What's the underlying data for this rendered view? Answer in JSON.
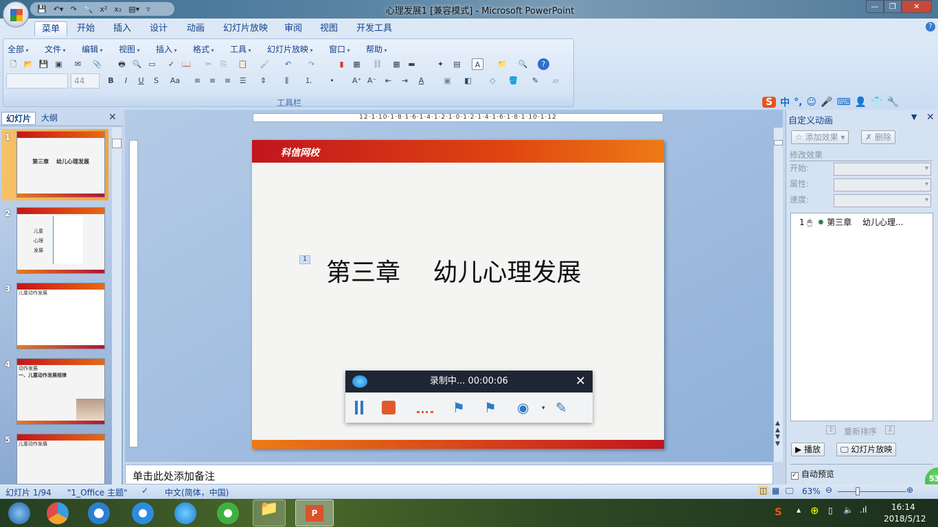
{
  "window": {
    "title": "心理发展1 [兼容模式] - Microsoft PowerPoint"
  },
  "ribbon": {
    "tabs": [
      "菜单",
      "开始",
      "插入",
      "设计",
      "动画",
      "幻灯片放映",
      "审阅",
      "视图",
      "开发工具"
    ],
    "selected_tab": "菜单",
    "menus": [
      "全部",
      "文件",
      "编辑",
      "视图",
      "插入",
      "格式",
      "工具",
      "幻灯片放映",
      "窗口",
      "帮助"
    ],
    "font_size": "44",
    "group_label": "工具栏"
  },
  "ime": {
    "label": "中",
    "punct": "°,"
  },
  "left_panel": {
    "tabs": [
      "幻灯片",
      "大纲"
    ],
    "thumbnails": [
      {
        "num": "1",
        "title": "第三章　 幼儿心理发展",
        "selected": true
      },
      {
        "num": "2",
        "title": "儿童\n心理\n发展"
      },
      {
        "num": "3",
        "title": "儿童动作发展"
      },
      {
        "num": "4",
        "title": "动作发展",
        "subtitle": "一、儿童动作发展规律"
      },
      {
        "num": "5",
        "title": "儿童动作发展"
      }
    ]
  },
  "slide": {
    "logo": "科信网校",
    "title": "第三章　 幼儿心理发展",
    "anim_marker": "1"
  },
  "ruler": {
    "horizontal": "12·1·10·1·8·1·6·1·4·1·2·1·0·1·2·1·4·1·6·1·8·1·10·1·12"
  },
  "notes": {
    "placeholder": "单击此处添加备注"
  },
  "recorder": {
    "status": "录制中... 00:00:06"
  },
  "animation_pane": {
    "title": "自定义动画",
    "add_effect": "添加效果",
    "remove": "删除",
    "modify_label": "修改效果",
    "start_label": "开始:",
    "property_label": "属性:",
    "speed_label": "速度:",
    "items": [
      {
        "num": "1",
        "name": "第三章　 幼儿心理..."
      }
    ],
    "reorder": "重新排序",
    "play": "播放",
    "slideshow": "幻灯片放映",
    "autopreview": "自动预览",
    "autopreview_checked": true
  },
  "status": {
    "slide": "幻灯片 1/94",
    "theme": "\"1_Office 主题\"",
    "language": "中文(简体，中国)",
    "zoom": "63%",
    "zoom_percent": 63
  },
  "badge": "53",
  "taskbar": {
    "time": "16:14",
    "date": "2018/5/12"
  }
}
